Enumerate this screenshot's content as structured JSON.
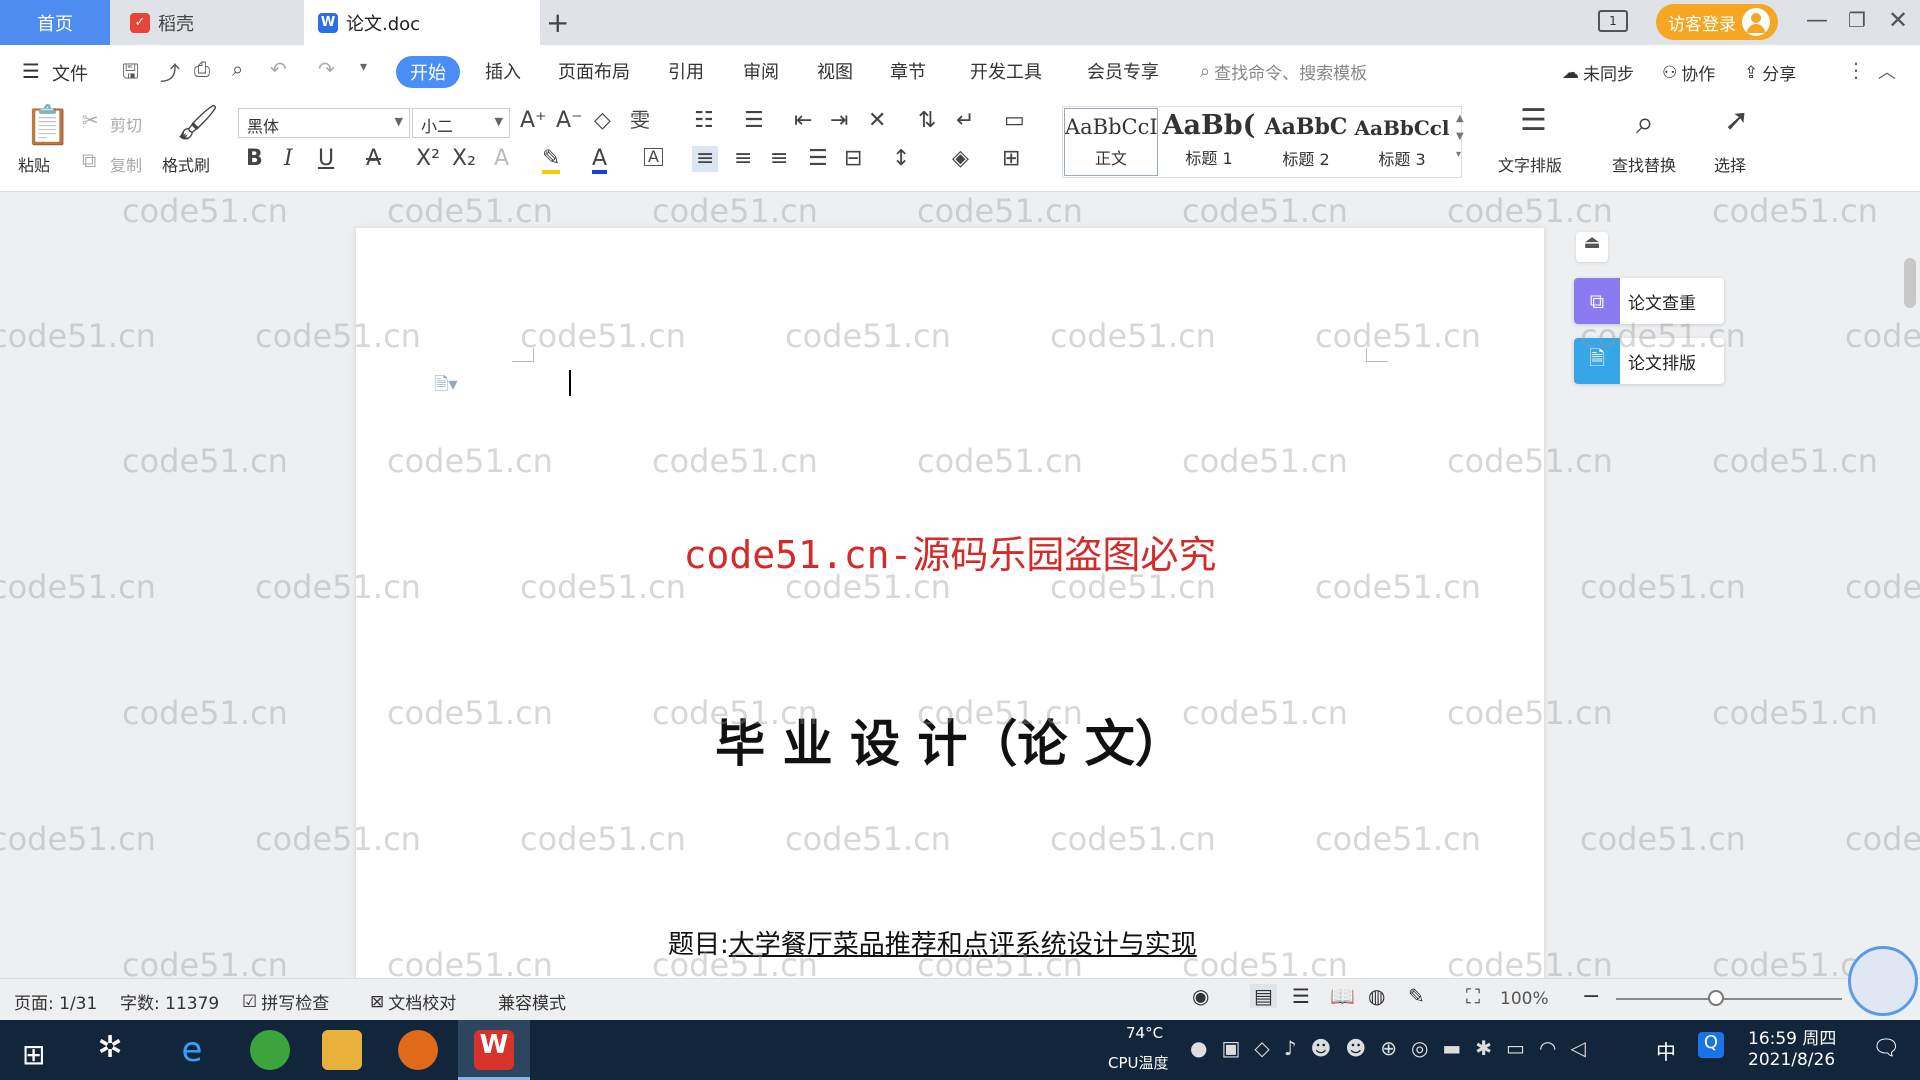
{
  "tabs": {
    "home": "首页",
    "daoke": "稻壳",
    "doc": "论文.doc",
    "add": "+"
  },
  "titlebar": {
    "visitor_login": "访客登录"
  },
  "menu": {
    "file": "文件",
    "items": [
      "开始",
      "插入",
      "页面布局",
      "引用",
      "审阅",
      "视图",
      "章节",
      "开发工具",
      "会员专享"
    ],
    "search_placeholder": "查找命令、搜索模板",
    "unsync": "未同步",
    "collab": "协作",
    "share": "分享"
  },
  "toolbar": {
    "paste": "粘贴",
    "cut": "剪切",
    "copy": "复制",
    "format_painter": "格式刷",
    "font_name": "黑体",
    "font_size": "小二",
    "styles": [
      {
        "preview": "AaBbCcI",
        "label": "正文"
      },
      {
        "preview": "AaBb(",
        "label": "标题 1"
      },
      {
        "preview": "AaBbC",
        "label": "标题 2"
      },
      {
        "preview": "AaBbCcl",
        "label": "标题 3"
      }
    ],
    "text_layout": "文字排版",
    "find_replace": "查找替换",
    "select": "选择"
  },
  "side_panel": {
    "check": "论文查重",
    "layout": "论文排版"
  },
  "document": {
    "banner": "code51.cn-源码乐园盗图必究",
    "heading": "毕 业 设 计（论 文）",
    "subject_label": "题目:",
    "subject_value": "大学餐厅菜品推荐和点评系统设计与实现"
  },
  "watermark": "code51.cn",
  "statusbar": {
    "page": "页面: 1/31",
    "words": "字数: 11379",
    "spell": "拼写检查",
    "proof": "文档校对",
    "compat": "兼容模式",
    "zoom": "100%"
  },
  "taskbar": {
    "cpu_temp": "74°C",
    "cpu_label": "CPU温度",
    "ime": "中",
    "time": "16:59 周四",
    "date": "2021/8/26"
  }
}
